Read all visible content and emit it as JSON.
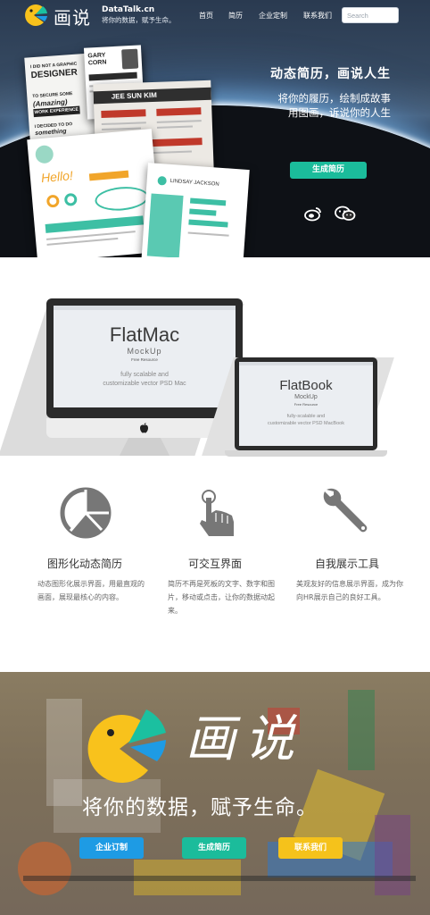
{
  "header": {
    "logo_cn": "画说",
    "logo_en": "DataTalk.cn",
    "logo_tagline": "将你的数据，赋予生命。",
    "nav": [
      "首页",
      "简历",
      "企业定制",
      "联系我们"
    ],
    "search_placeholder": "Search"
  },
  "hero": {
    "title": "动态简历，画说人生",
    "subtitle_line1": "将你的履历，绘制成故事",
    "subtitle_line2": "用图画，诉说你的人生",
    "cta": "生成简历",
    "social_icons": [
      "weibo-icon",
      "wechat-icon"
    ],
    "resume_texts": {
      "r1_a": "I DID NOT A GRAPHIC",
      "r1_b": "DESIGNER",
      "r1_c": "TO SECURE SOME",
      "r1_d": "(Amazing)",
      "r1_e": "WORK EXPERIENCE",
      "r1_f": "I DECIDED TO DO",
      "r1_g": "something",
      "r2_a": "GARY",
      "r2_b": "CORN",
      "r3_a": "JEE SUN KIM",
      "r4_a": "Hello!",
      "r5_a": "LINDSAY JACKSON"
    }
  },
  "devices": {
    "imac_title": "FlatMac",
    "imac_sub": "MockUp",
    "imac_free": "Free Resource",
    "imac_desc1": "fully scalable and",
    "imac_desc2": "customizable vector PSD Mac",
    "mb_title": "FlatBook",
    "mb_sub": "MockUp",
    "mb_free": "Free Resource",
    "mb_desc1": "fully-scalable and",
    "mb_desc2": "customizable vector PSD MacBook"
  },
  "features": [
    {
      "icon": "pie-chart-icon",
      "title": "图形化动态简历",
      "desc": "动态图形化展示界面，用最直观的画面，展现最核心的内容。"
    },
    {
      "icon": "hand-pointer-icon",
      "title": "可交互界面",
      "desc": "简历不再是死板的文字、数字和图片，移动或点击，让你的数据动起来。"
    },
    {
      "icon": "wrench-icon",
      "title": "自我展示工具",
      "desc": "美观友好的信息展示界面，成为你向HR展示自己的良好工具。"
    }
  ],
  "banner": {
    "logo_cn": "画说",
    "slogan": "将你的数据，赋予生命。",
    "buttons": [
      "企业订制",
      "生成简历",
      "联系我们"
    ]
  },
  "colors": {
    "green": "#1bbc9b",
    "blue": "#1e9be4",
    "yellow": "#f5c21b",
    "logo_yellow": "#f8c21c",
    "logo_teal": "#1bc0a0"
  }
}
